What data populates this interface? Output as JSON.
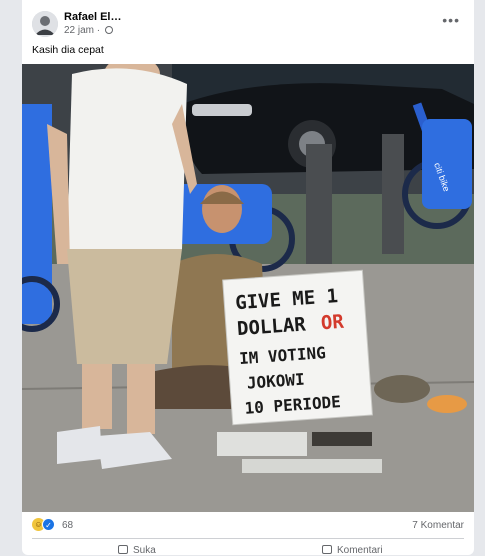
{
  "post": {
    "author": "Rafael El…",
    "timestamp": "22 jam",
    "privacy_icon": "globe-icon",
    "more_label": "•••",
    "caption": "Kasih dia cepat"
  },
  "photo": {
    "sign_lines": [
      "GIVE ME 1",
      "DOLLAR",
      "OR",
      "IM VOTING",
      "JOKOWI",
      "10 PERIODE"
    ],
    "bike_brand": "citi bike"
  },
  "stats": {
    "reaction_count": "68",
    "comment_count": "7 Komentar",
    "reactions": [
      "haha-icon",
      "like-icon"
    ]
  },
  "actions": {
    "like_label": "Suka",
    "comment_label": "Komentari"
  }
}
